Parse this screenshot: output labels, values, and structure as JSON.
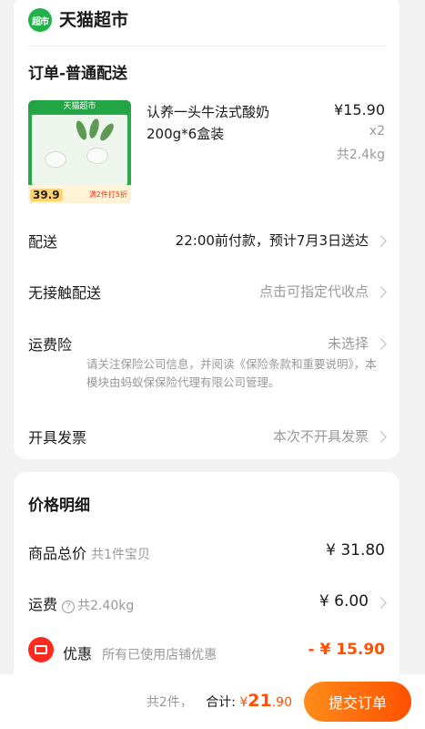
{
  "store": {
    "logo_text": "超市",
    "name": "天猫超市"
  },
  "order": {
    "section_title": "订单-普通配送",
    "product": {
      "image_banner": "天猫超市",
      "image_price": "39.9",
      "image_promo": "满2件打5折",
      "name": "认养一头牛法式酸奶200g*6盒装",
      "price": "¥15.90",
      "quantity": "x2",
      "weight": "共2.4kg"
    },
    "delivery": {
      "label": "配送",
      "value": "22:00前付款，预计7月3日送达"
    },
    "contactless": {
      "label": "无接触配送",
      "value": "点击可指定代收点"
    },
    "insurance": {
      "label": "运费险",
      "value": "未选择",
      "note": "请关注保险公司信息，并阅读《保险条款和重要说明》，本模块由蚂蚁保保险代理有限公司管理。"
    },
    "invoice": {
      "label": "开具发票",
      "value": "本次不开具发票"
    }
  },
  "price_detail": {
    "title": "价格明细",
    "goods_total": {
      "label": "商品总价",
      "sub": "共1件宝贝",
      "value": "¥ 31.80"
    },
    "shipping": {
      "label": "运费",
      "help": "?",
      "sub": "共2.40kg",
      "value": "¥ 6.00"
    },
    "discount": {
      "label": "优惠",
      "sub": "所有已使用店铺优惠",
      "value": "- ¥ 15.90"
    }
  },
  "footer": {
    "count": "共2件，",
    "total_label": "合计:",
    "currency": "¥",
    "total_int": "21",
    "total_dec": ".90",
    "submit_label": "提交订单"
  },
  "colors": {
    "accent": "#ff5000",
    "brand_green": "#21b24a",
    "coupon_red": "#ff2a1f"
  }
}
